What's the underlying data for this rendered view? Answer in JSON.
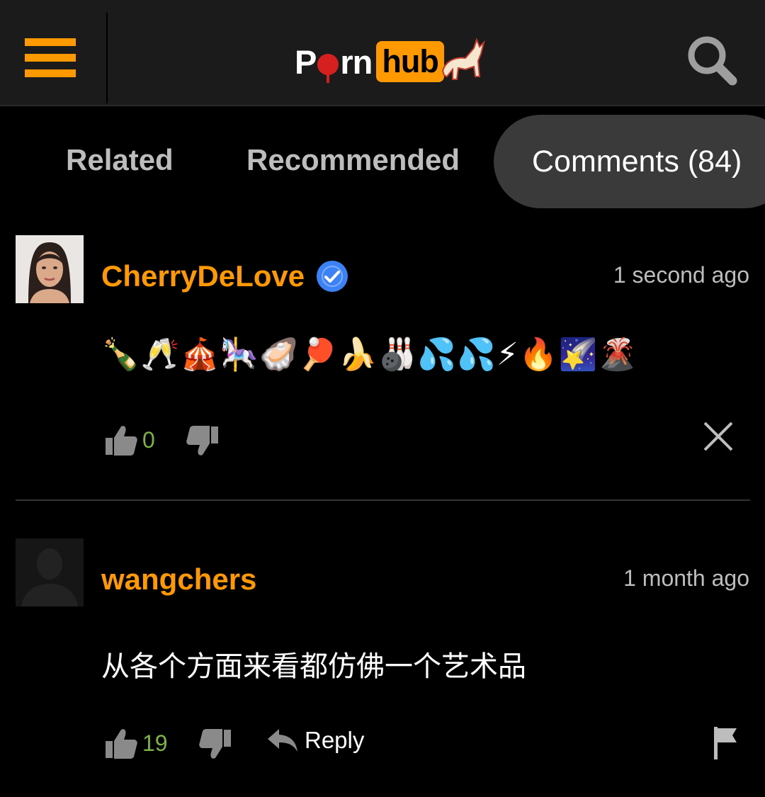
{
  "header": {
    "logo_left": "Pu2022rn",
    "logo_left_p": "P",
    "logo_left_rest": "rn",
    "logo_right": "hub"
  },
  "tabs": [
    {
      "label": "Related"
    },
    {
      "label": "Recommended"
    },
    {
      "label": "Comments (84)"
    }
  ],
  "comments": [
    {
      "username": "CherryDeLove",
      "verified": true,
      "timestamp": "1 second ago",
      "text": "🍾🥂🎪🎠🦪🏓🍌🎳💦💦⚡🔥🌠🌋",
      "likes": "0",
      "actions": {
        "close": "close-icon"
      }
    },
    {
      "username": "wangchers",
      "verified": false,
      "timestamp": "1 month ago",
      "text": "从各个方面来看都仿佛一个艺术品",
      "likes": "19",
      "reply_label": "Reply",
      "actions": {
        "flag": "flag-icon"
      }
    }
  ],
  "colors": {
    "accent": "#ff9900",
    "verified": "#3b82f6",
    "like_count": "#7cb342"
  }
}
